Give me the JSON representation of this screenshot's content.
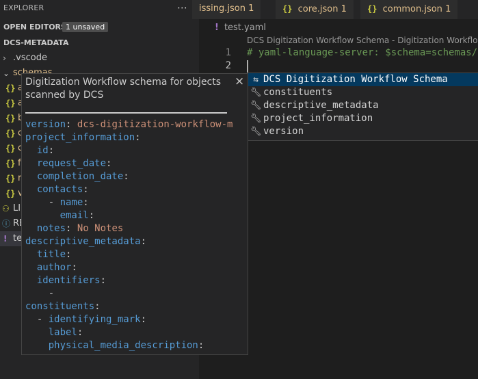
{
  "sidebar": {
    "title": "EXPLORER",
    "more_icon": "ellipsis-icon",
    "open_editors": "OPEN EDITORS",
    "unsaved_badge": "1 unsaved",
    "folder": "DCS-METADATA",
    "items": [
      {
        "label": ".vscode",
        "kind": "folder-collapsed"
      },
      {
        "label": "schemas",
        "kind": "folder-expanded"
      },
      {
        "label": "a",
        "kind": "json"
      },
      {
        "label": "a",
        "kind": "json"
      },
      {
        "label": "b",
        "kind": "json"
      },
      {
        "label": "c",
        "kind": "json"
      },
      {
        "label": "c",
        "kind": "json"
      },
      {
        "label": "f",
        "kind": "json"
      },
      {
        "label": "r",
        "kind": "json"
      },
      {
        "label": "v",
        "kind": "json"
      },
      {
        "label": "LI",
        "kind": "license"
      },
      {
        "label": "RE",
        "kind": "info"
      },
      {
        "label": "te",
        "kind": "yaml"
      }
    ]
  },
  "tabs": [
    {
      "label": "issing.json",
      "badge": "1"
    },
    {
      "label": "core.json",
      "badge": "1"
    },
    {
      "label": "common.json",
      "badge": "1"
    }
  ],
  "editor": {
    "breadcrumb_file": "test.yaml",
    "codelens": "DCS Digitization Workflow Schema - Digitization Workflow sc",
    "lines": [
      {
        "number": "1",
        "text": "# yaml-language-server: $schema=schemas/d"
      },
      {
        "number": "2",
        "text": ""
      }
    ]
  },
  "suggestions": {
    "items": [
      {
        "label": "DCS Digitization Workflow Schema",
        "icon": "snippet-icon"
      },
      {
        "label": "constituents",
        "icon": "wrench-icon"
      },
      {
        "label": "descriptive_metadata",
        "icon": "wrench-icon"
      },
      {
        "label": "project_information",
        "icon": "wrench-icon"
      },
      {
        "label": "version",
        "icon": "wrench-icon"
      }
    ]
  },
  "hover": {
    "description": "Digitization Workflow schema for objects scanned by DCS",
    "yaml": [
      {
        "key": "version",
        "value": "dcs-digitization-workflow-m"
      },
      {
        "key": "project_information"
      },
      {
        "indent": "  ",
        "key": "id"
      },
      {
        "indent": "  ",
        "key": "request_date"
      },
      {
        "indent": "  ",
        "key": "completion_date"
      },
      {
        "indent": "  ",
        "key": "contacts"
      },
      {
        "indent": "    - ",
        "key": "name"
      },
      {
        "indent": "      ",
        "key": "email"
      },
      {
        "indent": "  ",
        "key": "notes",
        "value": "No Notes"
      },
      {
        "key": "descriptive_metadata"
      },
      {
        "indent": "  ",
        "key": "title"
      },
      {
        "indent": "  ",
        "key": "author"
      },
      {
        "indent": "  ",
        "key": "identifiers"
      },
      {
        "indent": "    -",
        "key": ""
      },
      {
        "key": "constituents"
      },
      {
        "indent": "  - ",
        "key": "identifying_mark"
      },
      {
        "indent": "    ",
        "key": "label"
      },
      {
        "indent": "    ",
        "key": "physical_media_description"
      }
    ]
  }
}
